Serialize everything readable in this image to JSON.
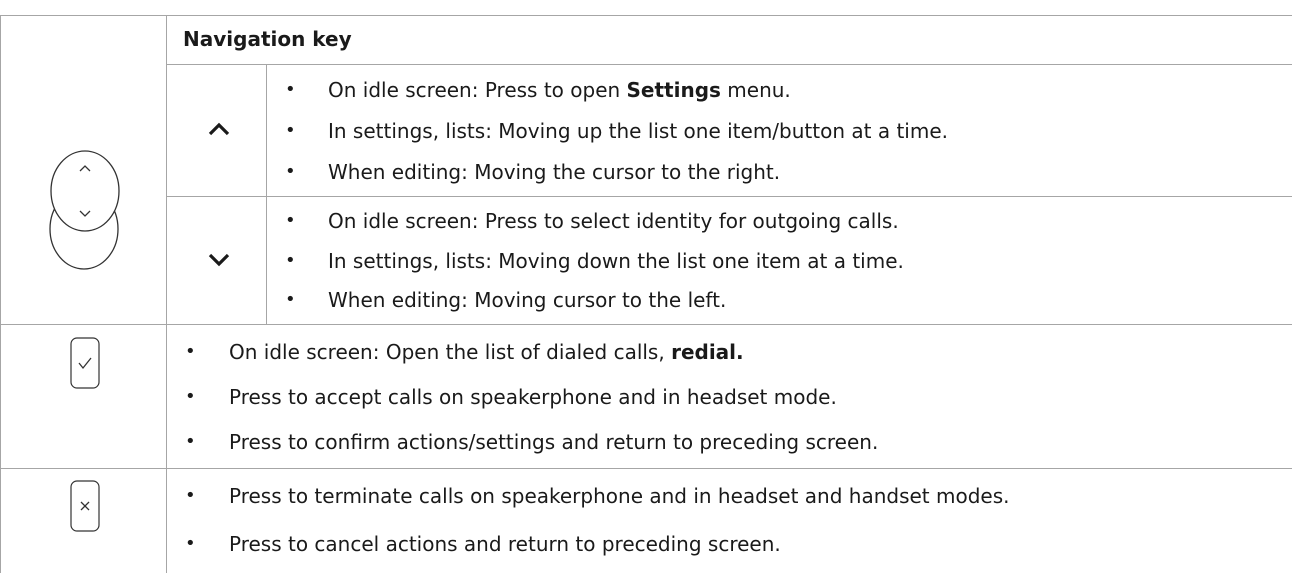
{
  "header": {
    "title": "Navigation key"
  },
  "bullet_char": "•",
  "up_key": {
    "icon": "chevron-up-icon",
    "items": [
      {
        "pre": "On idle screen:  Press to open ",
        "bold": "Settings",
        "post": " menu."
      },
      {
        "text": "In settings, lists:  Moving up the list one item/button at a time."
      },
      {
        "text": "When editing:  Moving the cursor to the right."
      }
    ]
  },
  "down_key": {
    "icon": "chevron-down-icon",
    "items": [
      {
        "text": "On idle screen:  Press to select identity for outgoing calls."
      },
      {
        "text": "In settings, lists:  Moving down the list one item at a time."
      },
      {
        "text": "When editing:  Moving cursor to the left."
      }
    ]
  },
  "accept_key": {
    "icon": "check-key-icon",
    "items": [
      {
        "pre": "On idle screen:  Open the list of dialed calls, ",
        "bold": "redial."
      },
      {
        "text": "Press to accept calls on speakerphone and in headset mode."
      },
      {
        "text": "Press to confirm actions/settings and return to preceding screen."
      }
    ]
  },
  "cancel_key": {
    "icon": "cancel-key-icon",
    "items": [
      {
        "text": "Press to terminate calls on speakerphone and in headset and handset modes."
      },
      {
        "text": "Press to cancel actions and return to preceding screen."
      }
    ]
  }
}
